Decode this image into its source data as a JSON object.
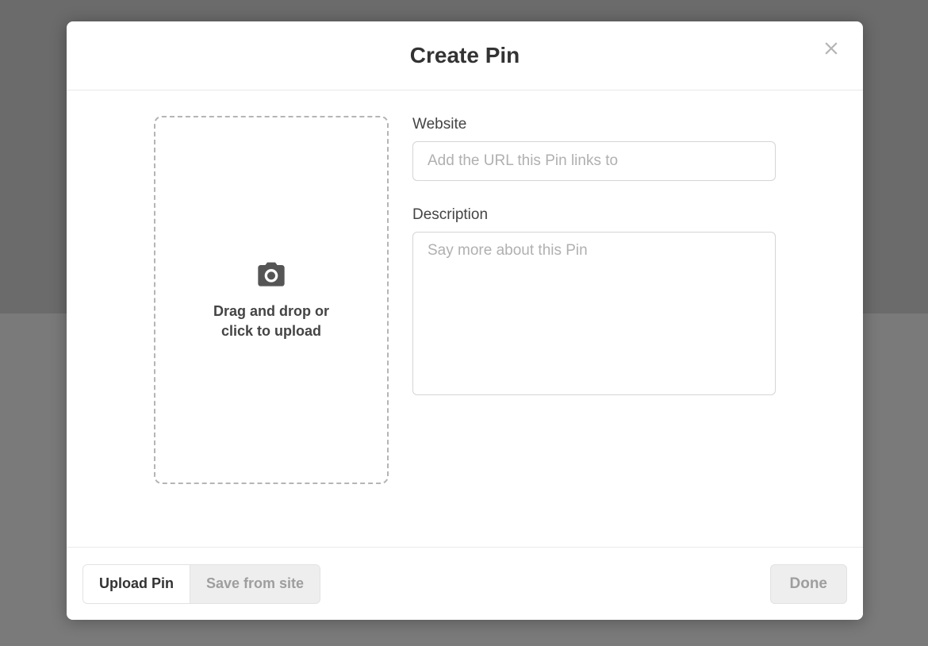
{
  "modal": {
    "title": "Create Pin",
    "upload": {
      "line1": "Drag and drop or",
      "line2": "click to upload"
    },
    "fields": {
      "website_label": "Website",
      "website_placeholder": "Add the URL this Pin links to",
      "website_value": "",
      "description_label": "Description",
      "description_placeholder": "Say more about this Pin",
      "description_value": ""
    },
    "footer": {
      "upload_pin": "Upload Pin",
      "save_from_site": "Save from site",
      "done": "Done"
    }
  }
}
